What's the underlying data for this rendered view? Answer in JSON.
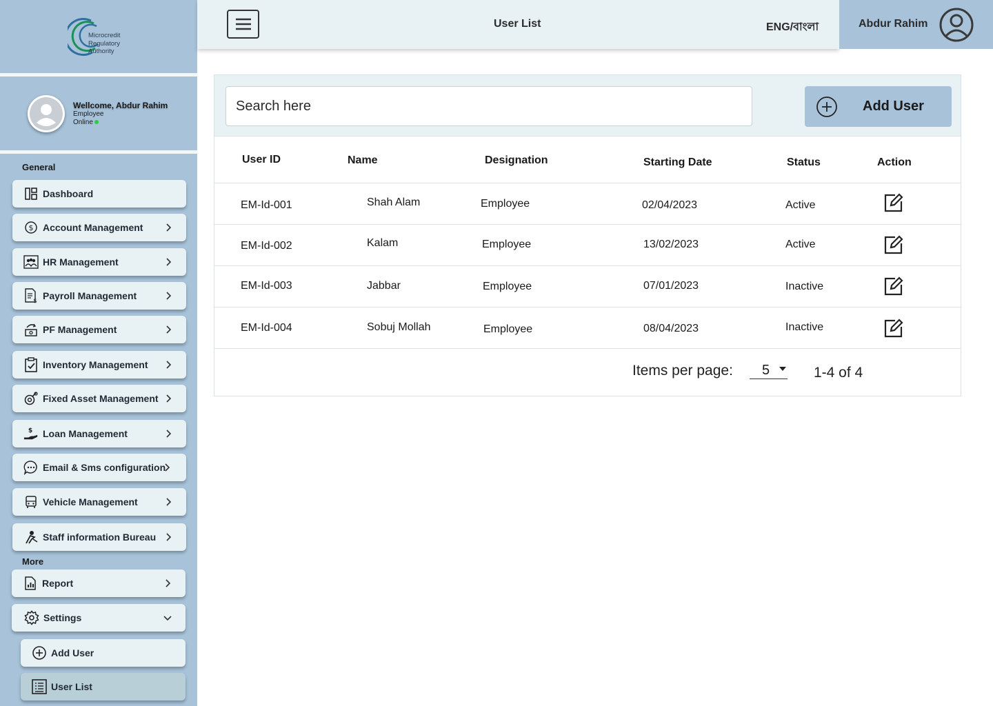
{
  "brand": {
    "logo_lines": [
      "Microcredit",
      "Regulatory",
      "Authority"
    ]
  },
  "profile": {
    "welcome": "Wellcome, Abdur Rahim",
    "role": "Employee",
    "status": "Online"
  },
  "sidebar": {
    "general_label": "General",
    "more_label": "More",
    "general_items": [
      {
        "label": "Dashboard",
        "icon": "dashboard-icon"
      },
      {
        "label": "Account Management",
        "icon": "dollar-circle-icon"
      },
      {
        "label": "HR Management",
        "icon": "people-icon"
      },
      {
        "label": "Payroll Management",
        "icon": "payroll-doc-icon"
      },
      {
        "label": "PF Management",
        "icon": "pf-transfer-icon"
      },
      {
        "label": "Inventory Management",
        "icon": "clipboard-check-icon"
      },
      {
        "label": "Fixed Asset Management",
        "icon": "asset-icon"
      },
      {
        "label": "Loan Management",
        "icon": "loan-hand-icon"
      },
      {
        "label": "Email & Sms configuration",
        "icon": "chat-icon"
      },
      {
        "label": "Vehicle Management",
        "icon": "bus-icon"
      },
      {
        "label": "Staff information Bureau",
        "icon": "staff-icon"
      }
    ],
    "more_items": [
      {
        "label": "Report",
        "icon": "report-icon"
      },
      {
        "label": "Settings",
        "icon": "gear-icon"
      }
    ],
    "settings_sub": [
      {
        "label": "Add User",
        "icon": "plus-circle-icon"
      },
      {
        "label": "User List",
        "icon": "list-icon"
      }
    ]
  },
  "header": {
    "title": "User List",
    "language": "ENG/বাংলা",
    "username": "Abdur Rahim"
  },
  "search": {
    "placeholder": "Search here"
  },
  "add_user_label": "Add User",
  "table": {
    "columns": [
      "User ID",
      "Name",
      "Designation",
      "Starting Date",
      "Status",
      "Action"
    ],
    "rows": [
      {
        "id": "EM-Id-001",
        "name": "Shah Alam",
        "designation": "Employee",
        "date": "02/04/2023",
        "status": "Active"
      },
      {
        "id": "EM-Id-002",
        "name": "Kalam",
        "designation": "Employee",
        "date": "13/02/2023",
        "status": "Active"
      },
      {
        "id": "EM-Id-003",
        "name": "Jabbar",
        "designation": "Employee",
        "date": "07/01/2023",
        "status": "Inactive"
      },
      {
        "id": "EM-Id-004",
        "name": "Sobuj Mollah",
        "designation": "Employee",
        "date": "08/04/2023",
        "status": "Inactive"
      }
    ]
  },
  "pagination": {
    "items_per_page_label": "Items per page:",
    "items_per_page": "5",
    "range": "1-4 of 4"
  }
}
